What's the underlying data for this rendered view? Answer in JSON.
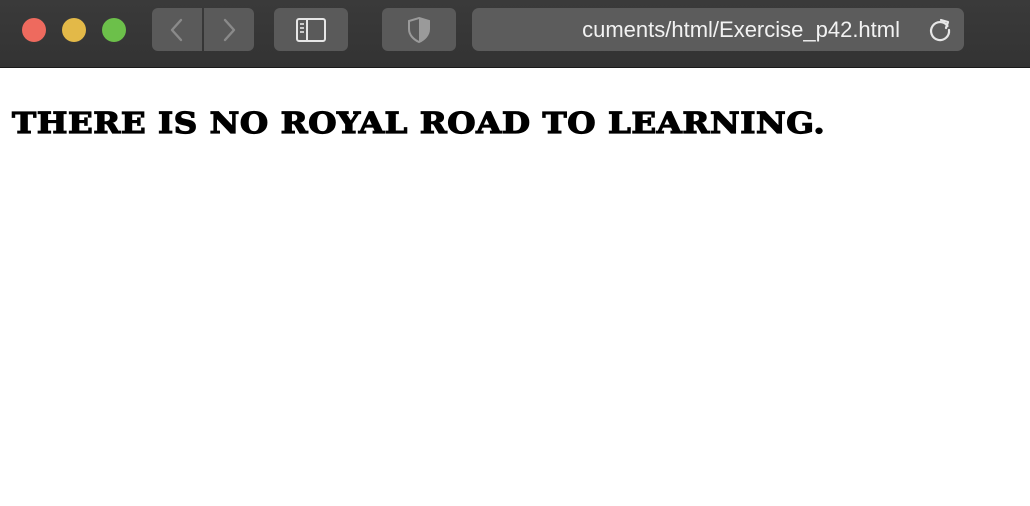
{
  "browser": {
    "address_bar": {
      "url_text": "cuments/html/Exercise_p42.html"
    },
    "buttons": {
      "back": "back-icon",
      "forward": "forward-icon",
      "sidebar": "sidebar-icon",
      "privacy": "shield-icon",
      "reload": "reload-icon"
    },
    "colors": {
      "close": "#ee6a5e",
      "minimize": "#e3b948",
      "zoom": "#6cc04a",
      "toolbar": "#383838"
    }
  },
  "page": {
    "heading": "THERE IS NO ROYAL ROAD TO LEARNING."
  }
}
